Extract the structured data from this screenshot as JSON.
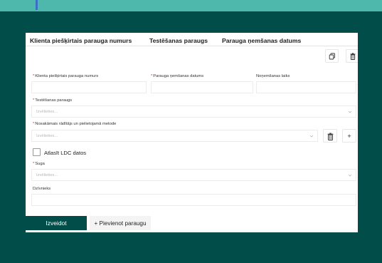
{
  "header": {
    "col1": "Klienta piešķirtais parauga numurs",
    "col2": "Testēšanas paraugs",
    "col3": "Parauga ņemšanas datums"
  },
  "form": {
    "required_mark": "*",
    "client_number_label": "Klienta piešķirtais parauga numurs",
    "sampling_date_label": "Parauga ņemšanas datums",
    "sampling_time_label": "Noņemšanas laiks",
    "test_sample_label": "Testēšanas paraugs",
    "test_sample_placeholder": "Izvēlieties...",
    "indicator_label": "Nosakāmais rādītājs un pielietojamā metode",
    "indicator_placeholder": "Izvēlieties...",
    "ldc_checkbox_label": "Atlasīt LDC datos",
    "species_label": "Suga",
    "species_placeholder": "Izvēlieties...",
    "animal_label": "Dzīvnieks"
  },
  "buttons": {
    "create": "Izveidot",
    "add_sample": "+ Pievienot paraugu",
    "add_plus": "+"
  },
  "icons": {
    "copy": "copy-icon",
    "delete": "trash-icon",
    "dropdown": "chevron-down-icon"
  },
  "colors": {
    "background": "#004d49",
    "top_strip": "#4fb8ad",
    "primary": "#004d49",
    "required": "#c0392b"
  }
}
